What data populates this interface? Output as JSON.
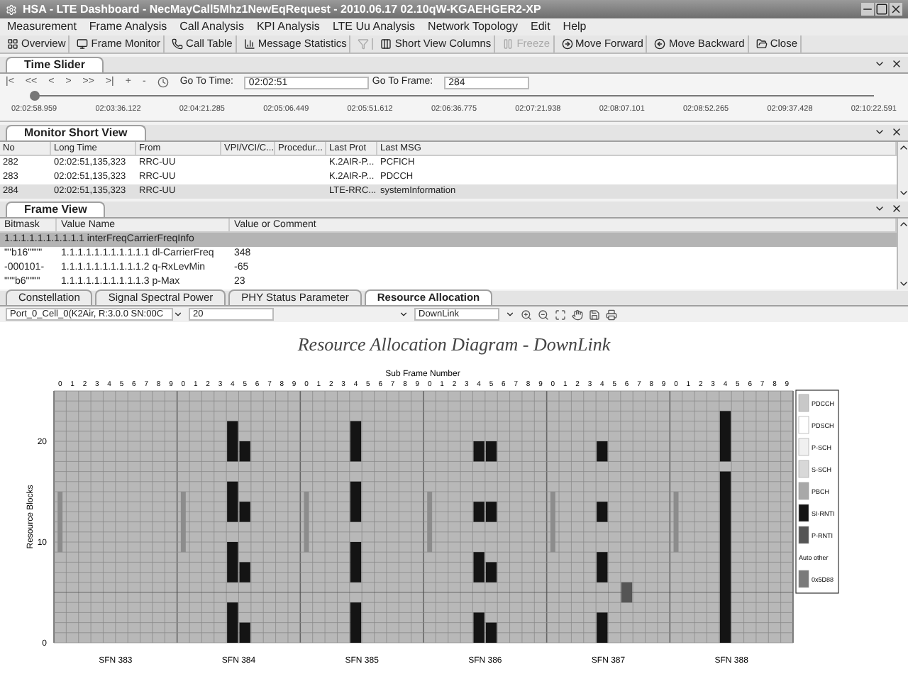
{
  "window": {
    "title": "HSA - LTE Dashboard - NecMayCall5Mhz1NewEqRequest - 2010.06.17 02.10qW-KGAEHGER2-XP"
  },
  "menu": [
    "Measurement",
    "Frame Analysis",
    "Call Analysis",
    "KPI Analysis",
    "LTE Uu Analysis",
    "Network Topology",
    "Edit",
    "Help"
  ],
  "toolbar": [
    {
      "label": "Overview",
      "disabled": false
    },
    {
      "label": "Frame Monitor",
      "disabled": false
    },
    {
      "label": "Call Table",
      "disabled": false
    },
    {
      "label": "Message Statistics",
      "disabled": false
    },
    {
      "disabled": true
    },
    {
      "label": "Short View Columns",
      "disabled": false
    },
    {
      "label": "Freeze",
      "disabled": true
    },
    {
      "label": "Move Forward",
      "disabled": false
    },
    {
      "label": "Move Backward",
      "disabled": false
    },
    {
      "label": "Close",
      "disabled": false
    }
  ],
  "time_slider": {
    "tab": "Time Slider",
    "nav": [
      "|<",
      "<<",
      "<",
      ">",
      ">>",
      ">|",
      "+",
      "-"
    ],
    "goto_time_label": "Go To Time:",
    "goto_time": "02:02:51",
    "goto_frame_label": "Go To Frame:",
    "goto_frame": "284",
    "level": 0.0,
    "ticks": [
      "02:02:58.959",
      "02:03:36.122",
      "02:04:21.285",
      "02:05:06.449",
      "02:05:51.612",
      "02:06:36.775",
      "02:07:21.938",
      "02:08:07.101",
      "02:08:52.265",
      "02:09:37.428",
      "02:10:22.591"
    ]
  },
  "monitor_short_view": {
    "tab": "Monitor Short View",
    "columns": [
      "No",
      "Long Time",
      "From",
      "VPI/VCI/C...",
      "Procedur...",
      "Last Prot",
      "Last MSG"
    ],
    "rows": [
      {
        "cells": [
          "282",
          "02:02:51,135,323",
          "RRC-UU",
          "",
          "",
          "K.2AIR-P...",
          "PCFICH"
        ],
        "selected": false
      },
      {
        "cells": [
          "283",
          "02:02:51,135,323",
          "RRC-UU",
          "",
          "",
          "K.2AIR-P...",
          "PDCCH"
        ],
        "selected": false
      },
      {
        "cells": [
          "284",
          "02:02:51,135,323",
          "RRC-UU",
          "",
          "",
          "LTE-RRC...",
          "systemInformation"
        ],
        "selected": true
      }
    ]
  },
  "frame_view": {
    "tab": "Frame View",
    "columns": [
      "Bitmask",
      "Value Name",
      "Value or Comment"
    ],
    "header_row": {
      "text": "1.1.1.1.1.1.1.1.1.1  interFreqCarrierFreqInfo",
      "selected": true
    },
    "rows": [
      {
        "cells": [
          "\"\"b16\"\"\"\"",
          "1.1.1.1.1.1.1.1.1.1.1  dl-CarrierFreq",
          "348"
        ]
      },
      {
        "cells": [
          "-000101-",
          "1.1.1.1.1.1.1.1.1.1.2  q-RxLevMin",
          "-65"
        ]
      },
      {
        "cells": [
          "\"\"\"b6\"\"\"\"",
          "1.1.1.1.1.1.1.1.1.1.3  p-Max",
          "23"
        ]
      }
    ]
  },
  "analysis_tabs": [
    {
      "label": "Constellation",
      "selected": false
    },
    {
      "label": "Signal Spectral Power",
      "selected": false
    },
    {
      "label": "PHY Status Parameter",
      "selected": false
    },
    {
      "label": "Resource Allocation",
      "selected": true
    }
  ],
  "chart_toolbar": {
    "cell": "Port_0_Cell_0(K2Air, R:3.0.0 SN:00C",
    "count": "20",
    "direction": "DownLink"
  },
  "diagram": {
    "title": "Resource Allocation Diagram - DownLink",
    "x_title": "Sub Frame Number",
    "y_title": "Resource Blocks",
    "y_ticks": [
      "20",
      "10",
      "0"
    ],
    "sfns": [
      {
        "label": "SFN 383",
        "subframes": [
          "0",
          "1",
          "2",
          "3",
          "4",
          "5",
          "6",
          "7",
          "8",
          "9"
        ]
      },
      {
        "label": "SFN 384",
        "subframes": [
          "0",
          "1",
          "2",
          "3",
          "4",
          "5",
          "6",
          "7",
          "8",
          "9"
        ]
      },
      {
        "label": "SFN 385",
        "subframes": [
          "0",
          "1",
          "2",
          "3",
          "4",
          "5",
          "6",
          "7",
          "8",
          "9"
        ]
      },
      {
        "label": "SFN 386",
        "subframes": [
          "0",
          "1",
          "2",
          "3",
          "4",
          "5",
          "6",
          "7",
          "8",
          "9"
        ]
      },
      {
        "label": "SFN 387",
        "subframes": [
          "0",
          "1",
          "2",
          "3",
          "4",
          "5",
          "6",
          "7",
          "8",
          "9"
        ]
      },
      {
        "label": "SFN 388",
        "subframes": [
          "0",
          "1",
          "2",
          "3",
          "4",
          "5",
          "6",
          "7",
          "8",
          "9"
        ]
      }
    ],
    "legend": [
      {
        "label": "PDCCH",
        "color": "#c8c8c8"
      },
      {
        "label": "PDSCH",
        "color": "#ffffff"
      },
      {
        "label": "P-SCH",
        "color": "#f0f0f0"
      },
      {
        "label": "S-SCH",
        "color": "#d8d8d8"
      },
      {
        "label": "PBCH",
        "color": "#a8a8a8"
      },
      {
        "label": "SI-RNTI",
        "color": "#141414"
      },
      {
        "label": "P-RNTI",
        "color": "#555555"
      },
      {
        "label": "Auto other"
      },
      {
        "label": "0x5D88",
        "color": "#7a7a7a"
      }
    ]
  }
}
